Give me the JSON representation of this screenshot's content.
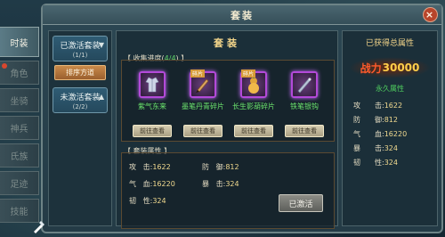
{
  "window": {
    "title": "套装",
    "close": "×"
  },
  "side_tabs": [
    {
      "label": "时装",
      "active": true
    },
    {
      "label": "角色"
    },
    {
      "label": "坐骑"
    },
    {
      "label": "神兵"
    },
    {
      "label": "氏族"
    },
    {
      "label": "足迹"
    },
    {
      "label": "技能"
    }
  ],
  "set_list": {
    "activated": {
      "label": "已激活套装",
      "count": "(1/1)"
    },
    "sort_label": "排序方道",
    "not_activated": {
      "label": "未激活套装",
      "count": "(2/2)"
    }
  },
  "center": {
    "title": "套装",
    "progress_prefix": "【 收集进度(",
    "progress_value": "4/4",
    "progress_suffix": ") 】",
    "items": [
      {
        "name": "紫气东来",
        "icon": "robe-icon",
        "fragment": ""
      },
      {
        "name": "墨笔丹青碎片",
        "icon": "brush-icon",
        "fragment": "碎片"
      },
      {
        "name": "长生影葫碎片",
        "icon": "gourd-icon",
        "fragment": "碎片"
      },
      {
        "name": "铁笔银钩",
        "icon": "pen-icon",
        "fragment": ""
      }
    ],
    "goto_label": "前往查看",
    "attr_title": "【 套装属性 】",
    "attrs": [
      {
        "k": "攻",
        "sep": "击:",
        "v": "1622"
      },
      {
        "k": "防",
        "sep": "御:",
        "v": "812"
      },
      {
        "k": "气",
        "sep": "血:",
        "v": "16220"
      },
      {
        "k": "暴",
        "sep": "击:",
        "v": "324"
      },
      {
        "k": "韧",
        "sep": "性:",
        "v": "324"
      }
    ],
    "activated_button": "已激活"
  },
  "right": {
    "title": "已获得总属性",
    "power_label": "战力",
    "power_value": "30000",
    "subtitle": "永久属性",
    "attrs": [
      {
        "k": "攻",
        "sep": "击:",
        "v": "1622"
      },
      {
        "k": "防",
        "sep": "御:",
        "v": "812"
      },
      {
        "k": "气",
        "sep": "血:",
        "v": "16220"
      },
      {
        "k": "暴",
        "sep": "击:",
        "v": "324"
      },
      {
        "k": "韧",
        "sep": "性:",
        "v": "324"
      }
    ]
  },
  "colors": {
    "accent_gold": "#f3d58a",
    "green": "#5fd66a",
    "purple_frame": "#b34ad9"
  }
}
